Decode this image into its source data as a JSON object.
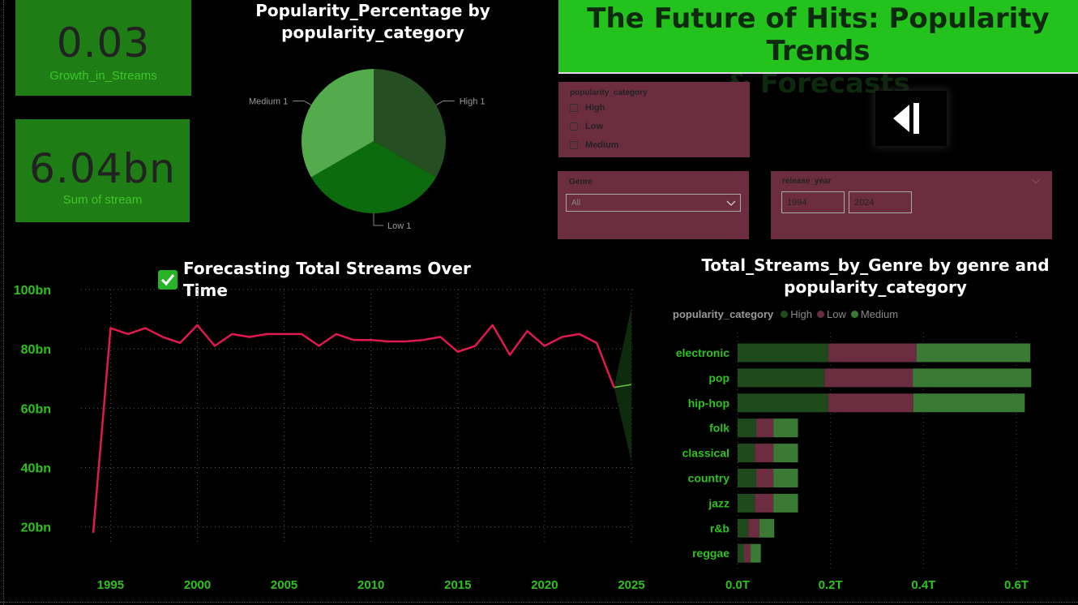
{
  "kpis": [
    {
      "value": "0.03",
      "label": "Growth_in_Streams"
    },
    {
      "value": "6.04bn",
      "label": "Sum of stream"
    }
  ],
  "banner": {
    "title_line1": "The Future of Hits: Popularity Trends",
    "title_line2": "& Forecasts"
  },
  "pie": {
    "title_line1": "Popularity_Percentage by",
    "title_line2": "popularity_category"
  },
  "popularity_slicer": {
    "header": "popularity_category",
    "options": [
      "High",
      "Low",
      "Medium"
    ]
  },
  "genre_slicer": {
    "header": "Genre",
    "value": "All"
  },
  "year_slicer": {
    "header": "release_year",
    "start": "1994",
    "end": "2024"
  },
  "line_chart": {
    "title": "Forecasting Total Streams Over Time"
  },
  "bar_chart": {
    "title_line1": "Total_Streams_by_Genre by genre and",
    "title_line2": "popularity_category",
    "legend_title": "popularity_category"
  },
  "colors": {
    "high": "#1f4a1c",
    "low": "#6b2d3f",
    "medium": "#3a7a35",
    "pie_high": "#254f22",
    "pie_low": "#0c6b0c",
    "pie_medium": "#54ab4c",
    "line": "#e0194e",
    "axis_text": "#2ec21f",
    "kpi_bg": "#1e7d14"
  },
  "chart_data": [
    {
      "type": "pie",
      "title": "Popularity_Percentage by popularity_category",
      "slices": [
        {
          "label": "High",
          "value": 1,
          "data_label": "High 1"
        },
        {
          "label": "Low",
          "value": 1,
          "data_label": "Low 1"
        },
        {
          "label": "Medium",
          "value": 1,
          "data_label": "Medium 1"
        }
      ]
    },
    {
      "type": "line",
      "title": "Forecasting Total Streams Over Time",
      "x": [
        1994,
        1995,
        1996,
        1997,
        1998,
        1999,
        2000,
        2001,
        2002,
        2003,
        2004,
        2005,
        2006,
        2007,
        2008,
        2009,
        2010,
        2011,
        2012,
        2013,
        2014,
        2015,
        2016,
        2017,
        2018,
        2019,
        2020,
        2021,
        2022,
        2023,
        2024
      ],
      "y": [
        18,
        87,
        85,
        87,
        84,
        82,
        88,
        81,
        85,
        84,
        85,
        85,
        85,
        81,
        85,
        83,
        83,
        82.5,
        82.5,
        83,
        84,
        79,
        81,
        88,
        78,
        86,
        81,
        84,
        85,
        82,
        67
      ],
      "forecast": {
        "x": [
          2024,
          2025
        ],
        "y": [
          67,
          68
        ],
        "upper": [
          67,
          94
        ],
        "lower": [
          67,
          42
        ]
      },
      "x_ticks": [
        "1995",
        "2000",
        "2005",
        "2010",
        "2015",
        "2020",
        "2025"
      ],
      "y_ticks": [
        "20bn",
        "40bn",
        "60bn",
        "80bn",
        "100bn"
      ],
      "xlim": [
        1993.3,
        2025
      ],
      "ylim": [
        15,
        100
      ],
      "y_unit": "bn",
      "grid": true
    },
    {
      "type": "bar",
      "orientation": "horizontal",
      "stacked": true,
      "title": "Total_Streams_by_Genre by genre and popularity_category",
      "categories": [
        "electronic",
        "pop",
        "hip-hop",
        "folk",
        "classical",
        "country",
        "jazz",
        "r&b",
        "reggae"
      ],
      "series": [
        {
          "name": "High",
          "values": [
            0.195,
            0.187,
            0.195,
            0.04,
            0.037,
            0.04,
            0.037,
            0.023,
            0.014
          ]
        },
        {
          "name": "Low",
          "values": [
            0.19,
            0.19,
            0.183,
            0.037,
            0.04,
            0.037,
            0.04,
            0.024,
            0.014
          ]
        },
        {
          "name": "Medium",
          "values": [
            0.245,
            0.255,
            0.24,
            0.053,
            0.053,
            0.053,
            0.053,
            0.032,
            0.022
          ]
        }
      ],
      "x_ticks": [
        "0.0T",
        "0.2T",
        "0.4T",
        "0.6T"
      ],
      "xlim": [
        0,
        0.7
      ],
      "x_unit": "T",
      "legend_position": "top-left"
    }
  ]
}
